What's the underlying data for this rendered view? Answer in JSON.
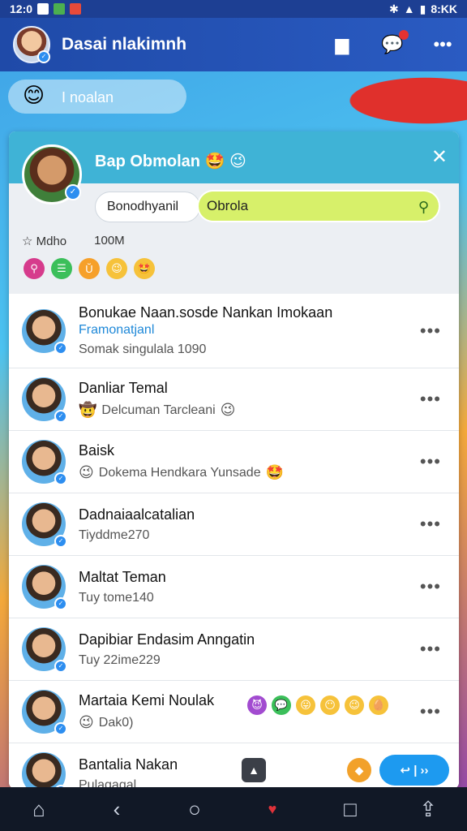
{
  "status_bar": {
    "time": "12:0",
    "clock_right": "8:KK"
  },
  "header": {
    "title": "Dasai nlakimnh",
    "icons": [
      "avatar",
      "folder-icon",
      "chat-bubble-icon",
      "more-icon"
    ],
    "more_label": "•••"
  },
  "banner": {
    "label": "I noalan",
    "emoji": "😊"
  },
  "group_card": {
    "title": "Bap Obmolan 🤩 😉",
    "close_label": "✕",
    "pill_label": "Bonodhyanil",
    "search_value": "Obrola",
    "stats": {
      "label": "Mdho",
      "value": "100M"
    },
    "reactions": [
      {
        "icon": "⚲",
        "color": "#d63b8c"
      },
      {
        "icon": "☰",
        "color": "#3bbf5a"
      },
      {
        "icon": "Ŭ",
        "color": "#f6a02a"
      },
      {
        "icon": "😉",
        "color": "#f6c23a"
      },
      {
        "icon": "🤩",
        "color": "#f6c23a"
      }
    ]
  },
  "chats": [
    {
      "name": "Bonukae Naan.sosde Nankan Imokaan",
      "link": "Framonatjanl",
      "subtitle": "Somak singulala 1090",
      "more": "•••"
    },
    {
      "name": "Danliar Temal",
      "subtitle": "Delcuman Tarcleani",
      "sub_emoji": "😉",
      "sub_icon": "🤠",
      "more": "•••"
    },
    {
      "name": "Baisk",
      "subtitle": "Dokema Hendkara Yunsade",
      "sub_emoji": "🤩",
      "sub_icon": "😉",
      "more": "•••"
    },
    {
      "name": "Dadnaiaalcatalian",
      "subtitle": "Tiyddme270",
      "more": "•••"
    },
    {
      "name": "Maltat Teman",
      "subtitle": "Tuy tome140",
      "more": "•••"
    },
    {
      "name": "Dapibiar Endasim Anngatin",
      "subtitle": "Tuy 22ime229",
      "more": "•••"
    },
    {
      "name": "Martaia Kemi Noulak",
      "subtitle": "Dak0)",
      "sub_icon": "😉",
      "more": "•••",
      "emoji_strip": [
        "😈",
        "💬",
        "😛",
        "😶",
        "😉",
        "🥚"
      ]
    },
    {
      "name": "Bantalia Nakan",
      "subtitle": "Pulagagal",
      "send_label": "↩ | ››"
    }
  ],
  "bottom_nav": [
    "⌂",
    "‹",
    "○",
    "♥",
    "□",
    "⇪"
  ]
}
